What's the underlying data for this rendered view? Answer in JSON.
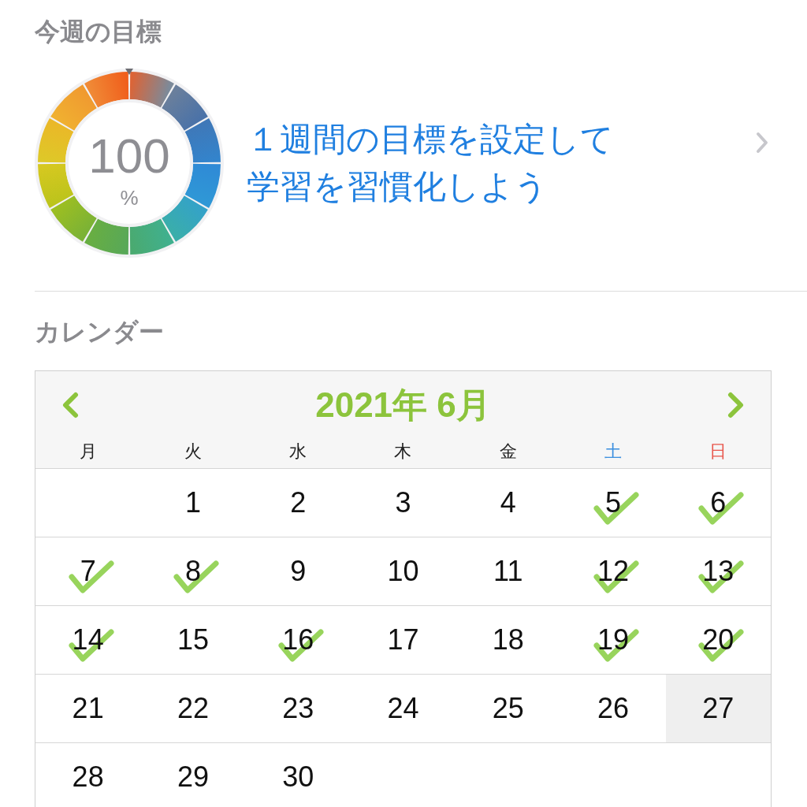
{
  "weekly_goal": {
    "heading": "今週の目標",
    "progress": {
      "value": "100",
      "unit": "%",
      "level": 1
    },
    "prompt_lines": [
      "１週間の目標を設定して",
      "学習を習慣化しよう"
    ]
  },
  "calendar": {
    "heading": "カレンダー",
    "title": "2021年 6月",
    "weekdays": [
      {
        "label": "月",
        "kind": "weekday"
      },
      {
        "label": "火",
        "kind": "weekday"
      },
      {
        "label": "水",
        "kind": "weekday"
      },
      {
        "label": "木",
        "kind": "weekday"
      },
      {
        "label": "金",
        "kind": "weekday"
      },
      {
        "label": "土",
        "kind": "saturday"
      },
      {
        "label": "日",
        "kind": "sunday"
      }
    ],
    "weeks": [
      [
        {
          "day": "1",
          "checked": false,
          "selected": false
        },
        {
          "day": "2",
          "checked": false,
          "selected": false
        },
        {
          "day": "3",
          "checked": false,
          "selected": false
        },
        {
          "day": "4",
          "checked": false,
          "selected": false
        },
        {
          "day": "5",
          "checked": true,
          "selected": false
        },
        {
          "day": "6",
          "checked": true,
          "selected": false
        }
      ],
      [
        {
          "day": "7",
          "checked": true,
          "selected": false
        },
        {
          "day": "8",
          "checked": true,
          "selected": false
        },
        {
          "day": "9",
          "checked": false,
          "selected": false
        },
        {
          "day": "10",
          "checked": false,
          "selected": false
        },
        {
          "day": "11",
          "checked": false,
          "selected": false
        },
        {
          "day": "12",
          "checked": true,
          "selected": false
        },
        {
          "day": "13",
          "checked": true,
          "selected": false
        }
      ],
      [
        {
          "day": "14",
          "checked": true,
          "selected": false
        },
        {
          "day": "15",
          "checked": false,
          "selected": false
        },
        {
          "day": "16",
          "checked": true,
          "selected": false
        },
        {
          "day": "17",
          "checked": false,
          "selected": false
        },
        {
          "day": "18",
          "checked": false,
          "selected": false
        },
        {
          "day": "19",
          "checked": true,
          "selected": false
        },
        {
          "day": "20",
          "checked": true,
          "selected": false
        }
      ],
      [
        {
          "day": "21",
          "checked": false,
          "selected": false
        },
        {
          "day": "22",
          "checked": false,
          "selected": false
        },
        {
          "day": "23",
          "checked": false,
          "selected": false
        },
        {
          "day": "24",
          "checked": false,
          "selected": false
        },
        {
          "day": "25",
          "checked": false,
          "selected": false
        },
        {
          "day": "26",
          "checked": false,
          "selected": false
        },
        {
          "day": "27",
          "checked": false,
          "selected": true
        }
      ],
      [
        {
          "day": "28",
          "checked": false,
          "selected": false
        },
        {
          "day": "29",
          "checked": false,
          "selected": false
        },
        {
          "day": "30",
          "checked": false,
          "selected": false
        }
      ]
    ]
  }
}
